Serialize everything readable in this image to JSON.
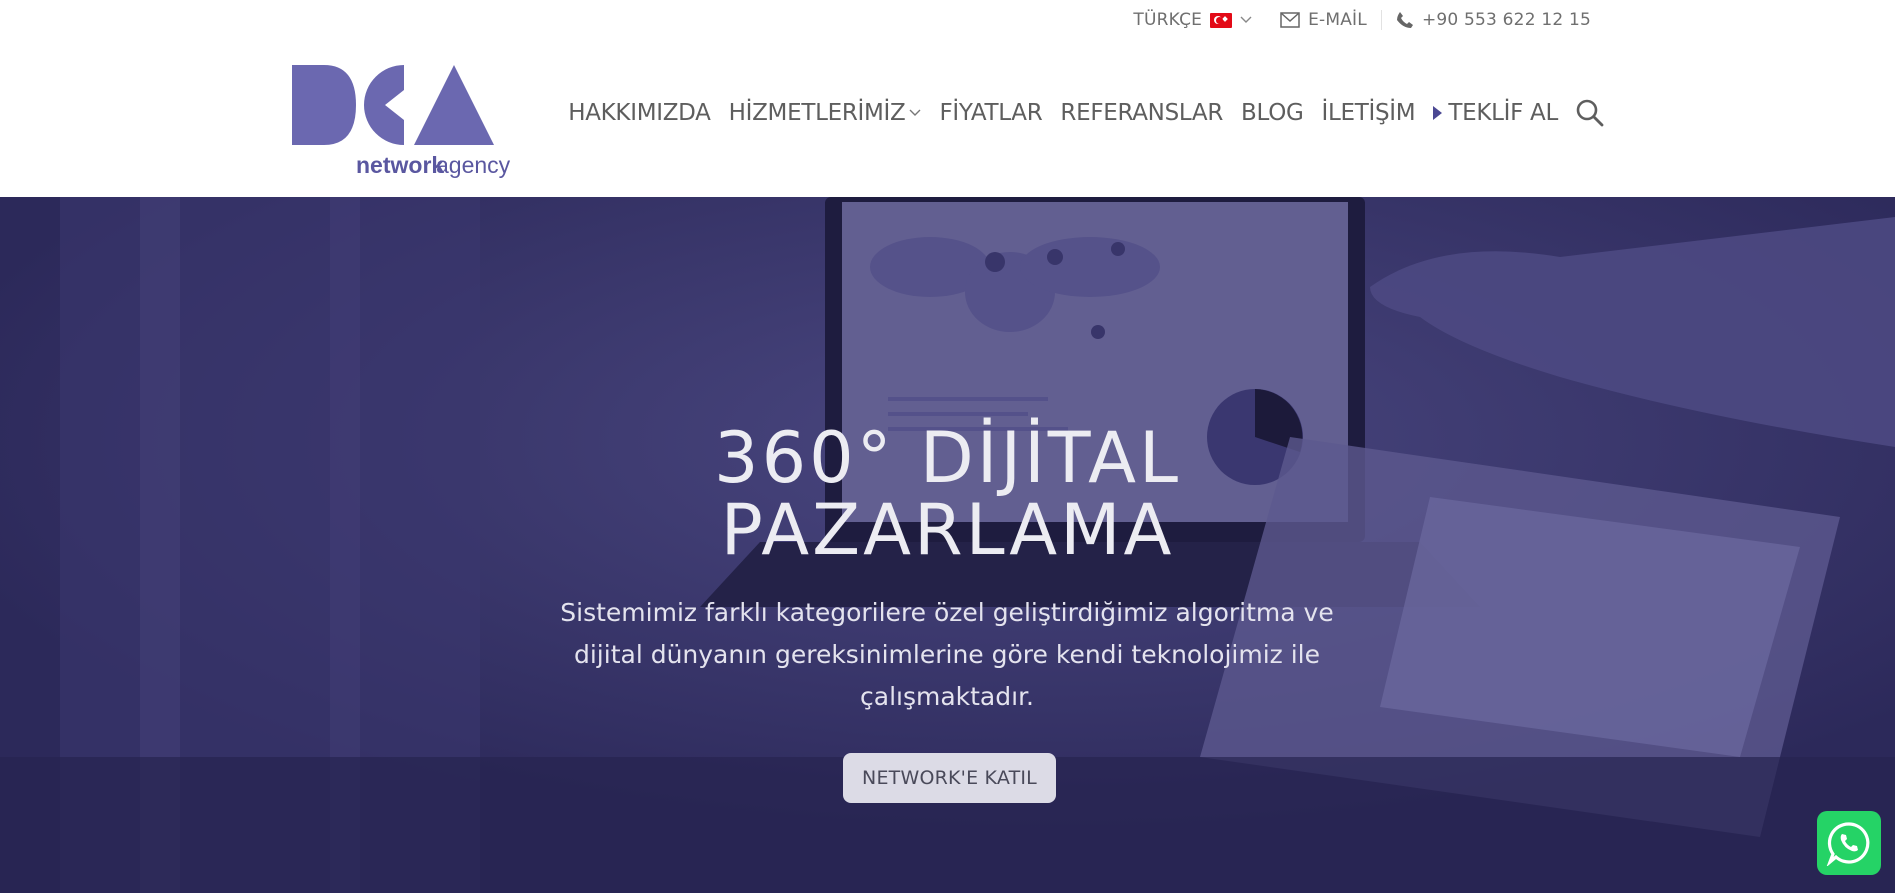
{
  "topbar": {
    "language_label": "TÜRKÇE",
    "language_flag": "turkey-flag-icon",
    "email_label": "E-MAİL",
    "phone_label": "+90 553 622 12 15"
  },
  "header": {
    "logo_text": "DCA",
    "logo_tagline_bold": "network",
    "logo_tagline_light": "agency",
    "nav": {
      "about": "HAKKIMIZDA",
      "services": "HİZMETLERİMİZ",
      "prices": "FİYATLAR",
      "references": "REFERANSLAR",
      "blog": "BLOG",
      "contact": "İLETİŞİM",
      "quote": "TEKLİF AL"
    }
  },
  "hero": {
    "title_line1": "360° DİJİTAL",
    "title_line2": "PAZARLAMA",
    "subtitle": "Sistemimiz farklı kategorilere özel geliştirdiğimiz algoritma ve dijital dünyanın gereksinimlerine göre kendi teknolojimiz ile çalışmaktadır.",
    "cta_label": "NETWORK'E KATIL"
  },
  "colors": {
    "brand": "#6b68b0",
    "hero_overlay": "#322f63",
    "whatsapp": "#25d366"
  }
}
